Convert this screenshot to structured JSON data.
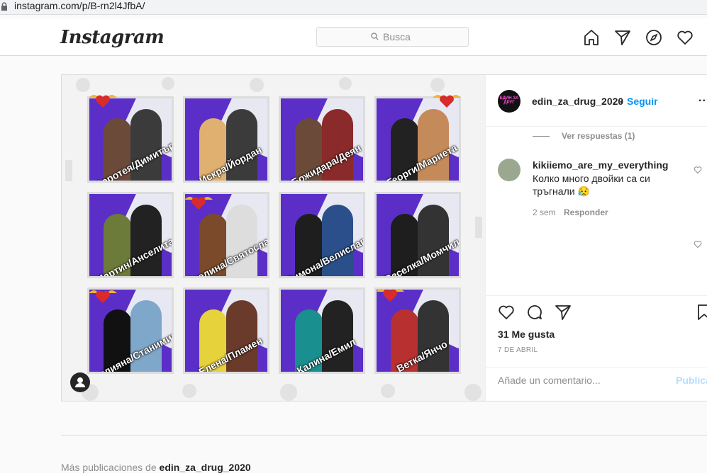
{
  "browser": {
    "url": "instagram.com/p/B-rn2l4JfbA/"
  },
  "nav": {
    "logo": "Instagram",
    "search_placeholder": "Busca",
    "icons": [
      "home-icon",
      "direct-icon",
      "explore-icon",
      "activity-icon"
    ]
  },
  "post": {
    "username": "edin_za_drug_2020",
    "follow_label": "Seguir",
    "dot": "•",
    "more_label": "...",
    "avatar_text": "ЕДИН ЗА ДРУГ",
    "tiles": [
      "Доротея/Димитър",
      "Искра/Йордан",
      "Божидара/Деян",
      "Георги/Мариета",
      "Мартин/Анселита",
      "Ивелина/Святослав",
      "Симона/Велислав",
      "Веселка/Момчил",
      "Вилияна/Станимир",
      "Елена/Пламен",
      "Калина/Емил",
      "Ветка/Янчо"
    ],
    "replies_label": "Ver respuestas (1)",
    "comment": {
      "user": "kikiiemo_are_my_everything",
      "text": "Колко много двойки са си тръгнали 😥",
      "time": "2 sem",
      "reply_label": "Responder"
    },
    "likes": "31 Me gusta",
    "date": "7 DE ABRIL",
    "comment_placeholder": "Añade un comentario...",
    "publish_label": "Publica"
  },
  "footer": {
    "more_prefix": "Más publicaciones de",
    "more_user": "edin_za_drug_2020"
  }
}
